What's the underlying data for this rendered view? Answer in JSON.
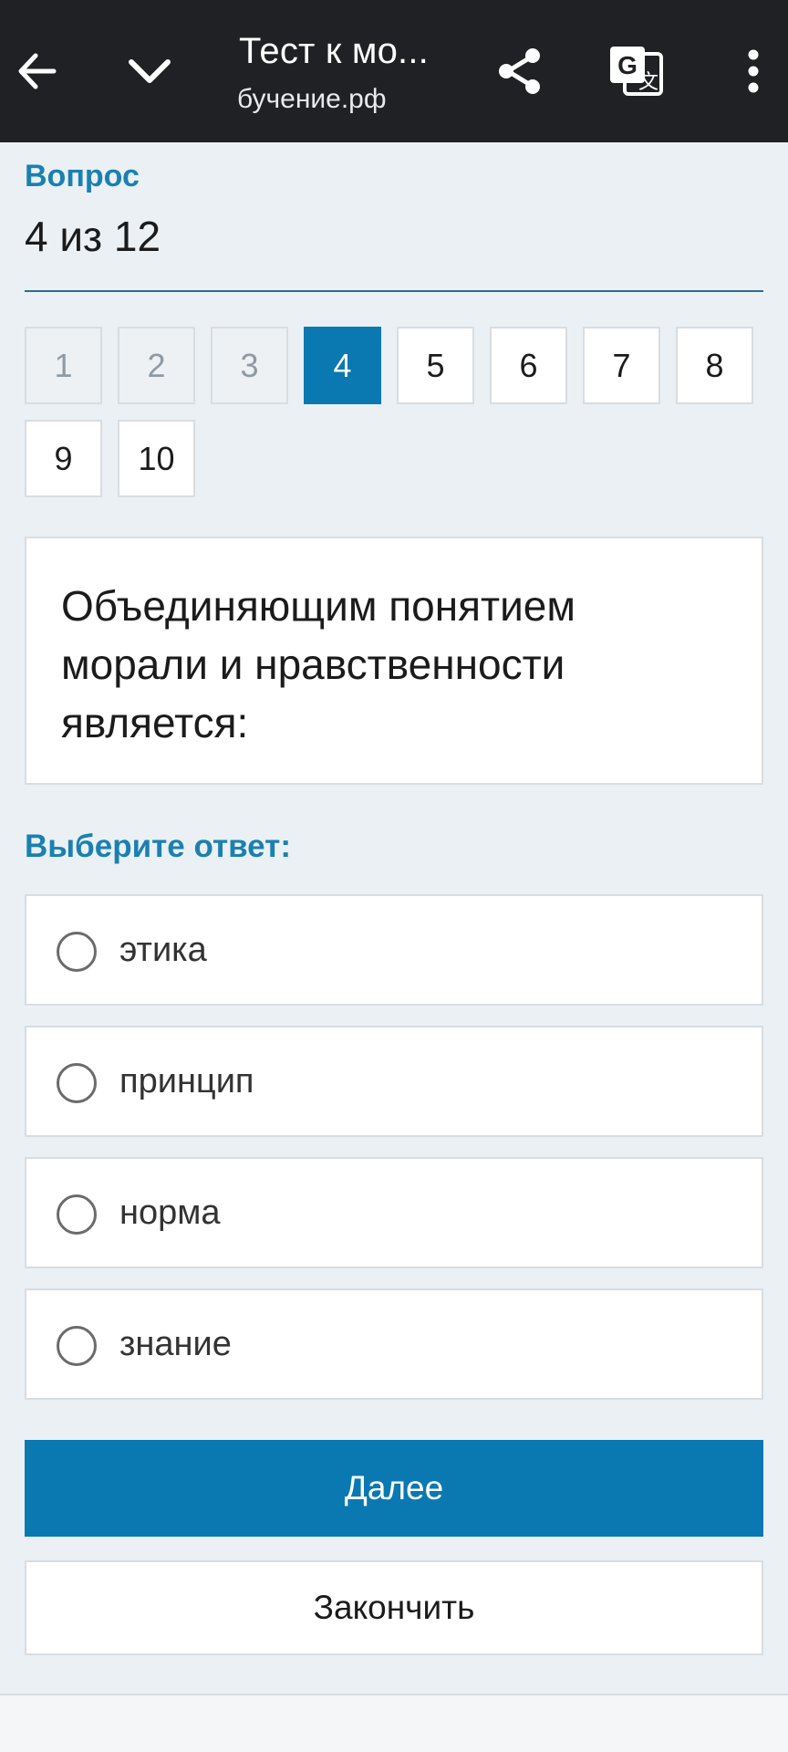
{
  "browser": {
    "title": "Тест к мо...",
    "url": "бучение.рф",
    "icons": {
      "back": "arrow-left-icon",
      "collapse": "chevron-down-icon",
      "share": "share-icon",
      "translate": "translate-icon",
      "more": "more-vert-icon"
    }
  },
  "quiz": {
    "question_label": "Вопрос",
    "counter": "4 из 12",
    "nav": [
      {
        "label": "1",
        "state": "visited"
      },
      {
        "label": "2",
        "state": "visited"
      },
      {
        "label": "3",
        "state": "visited"
      },
      {
        "label": "4",
        "state": "current"
      },
      {
        "label": "5",
        "state": "default"
      },
      {
        "label": "6",
        "state": "default"
      },
      {
        "label": "7",
        "state": "default"
      },
      {
        "label": "8",
        "state": "default"
      },
      {
        "label": "9",
        "state": "default"
      },
      {
        "label": "10",
        "state": "default"
      }
    ],
    "question_text": "Объединяющим понятием морали и нравственности является:",
    "answer_prompt": "Выберите ответ:",
    "options": [
      {
        "label": "этика",
        "selected": false
      },
      {
        "label": "принцип",
        "selected": false
      },
      {
        "label": "норма",
        "selected": false
      },
      {
        "label": "знание",
        "selected": false
      }
    ],
    "next_label": "Далее",
    "finish_label": "Закончить"
  },
  "colors": {
    "accent": "#0a78b1",
    "label": "#1b80b0",
    "topbar": "#202124",
    "background": "#eaf0f4"
  }
}
